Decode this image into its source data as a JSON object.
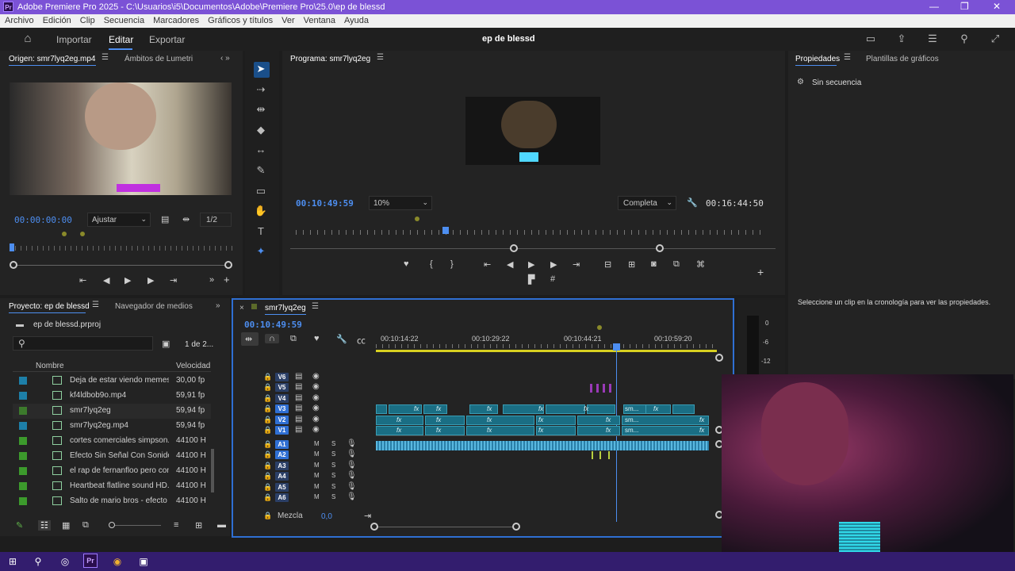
{
  "window": {
    "title": "Adobe Premiere Pro 2025 - C:\\Usuarios\\i5\\Documentos\\Adobe\\Premiere Pro\\25.0\\ep de blessd",
    "app_badge": "Pr"
  },
  "menu": [
    "Archivo",
    "Edición",
    "Clip",
    "Secuencia",
    "Marcadores",
    "Gráficos y títulos",
    "Ver",
    "Ventana",
    "Ayuda"
  ],
  "header": {
    "tabs": [
      "Importar",
      "Editar",
      "Exportar"
    ],
    "active_tab": "Editar",
    "project_title": "ep de blessd"
  },
  "source_panel": {
    "tabs": [
      "Origen: smr7lyq2eg.mp4",
      "Ámbitos de Lumetri"
    ],
    "timecode": "00:00:00:00",
    "fit": "Ajustar",
    "resolution": "1/2"
  },
  "program_panel": {
    "title": "Programa: smr7lyq2eg",
    "timecode": "00:10:49:59",
    "zoom": "10%",
    "quality": "Completa",
    "duration": "00:16:44:50"
  },
  "properties_panel": {
    "tabs": [
      "Propiedades",
      "Plantillas de gráficos"
    ],
    "no_sequence": "Sin secuencia",
    "hint": "Seleccione un clip en la cronología para ver las propiedades."
  },
  "project_panel": {
    "tabs": [
      "Proyecto: ep de blessd",
      "Navegador de medios"
    ],
    "file": "ep de blessd.prproj",
    "count": "1 de 2...",
    "columns": {
      "name": "Nombre",
      "speed": "Velocidad"
    },
    "items": [
      {
        "name": "Deja de estar viendo memes",
        "speed": "30,00 fp",
        "color": "#1d7fa8"
      },
      {
        "name": "kf4ldbob9o.mp4",
        "speed": "59,91 fp",
        "color": "#1d7fa8"
      },
      {
        "name": "smr7lyq2eg",
        "speed": "59,94 fp",
        "color": "#3c7a2c"
      },
      {
        "name": "smr7lyq2eg.mp4",
        "speed": "59,94 fp",
        "color": "#1d7fa8"
      },
      {
        "name": "cortes comerciales simpson.",
        "speed": "44100 H",
        "color": "#3c9a2c"
      },
      {
        "name": "Efecto Sin Señal Con Sonido.",
        "speed": "44100 H",
        "color": "#3c9a2c"
      },
      {
        "name": "el rap de fernanfloo pero con",
        "speed": "44100 H",
        "color": "#3c9a2c"
      },
      {
        "name": "Heartbeat flatline sound HD.",
        "speed": "44100 H",
        "color": "#3c9a2c"
      },
      {
        "name": "Salto de mario bros - efecto",
        "speed": "44100 H",
        "color": "#3c9a2c"
      }
    ]
  },
  "timeline": {
    "tab": "smr7lyq2eg",
    "timecode": "00:10:49:59",
    "ruler": [
      "00:10:14:22",
      "00:10:29:22",
      "00:10:44:21",
      "00:10:59:20"
    ],
    "video_tracks": [
      "V6",
      "V5",
      "V4",
      "V3",
      "V2",
      "V1"
    ],
    "audio_tracks": [
      "A1",
      "A2",
      "A3",
      "A4",
      "A5",
      "A6"
    ],
    "mix_label": "Mezcla",
    "mix_value": "0,0",
    "clip_fx": "fx",
    "clip_sm": "sm..."
  },
  "meter": {
    "labels": [
      "0",
      "-6",
      "-12"
    ]
  },
  "colors": {
    "accent": "#4d8ef0",
    "title_bar": "#7b52d6",
    "taskbar": "#331d6e",
    "clip": "#1a6e84",
    "audio": "#2a8fb8"
  }
}
